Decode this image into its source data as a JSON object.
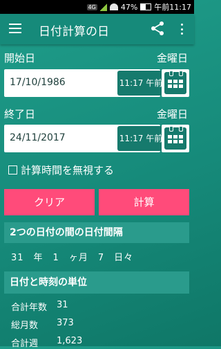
{
  "status": {
    "network": "4G",
    "battery": "47%",
    "clock": "午前11:17"
  },
  "appbar": {
    "title": "日付計算の日"
  },
  "start": {
    "label": "開始日",
    "weekday": "金曜日",
    "date": "17/10/1986",
    "time": "11:17 午前"
  },
  "end": {
    "label": "終了日",
    "weekday": "金曜日",
    "date": "24/11/2017",
    "time": "11:17 午前"
  },
  "ignore_time_label": "計算時間を無視する",
  "buttons": {
    "clear": "クリア",
    "calculate": "計算"
  },
  "interval": {
    "title": "2つの日付の間の日付間隔",
    "result": "31　年　1　ヶ月　7　日々"
  },
  "units": {
    "title": "日付と時刻の単位",
    "rows": [
      {
        "label": "合計年数",
        "value": "31"
      },
      {
        "label": "総月数",
        "value": "373"
      },
      {
        "label": "合計週",
        "value": "1,623"
      }
    ]
  },
  "colors": {
    "background": "#168a7a",
    "accent": "#ff4b7a"
  }
}
